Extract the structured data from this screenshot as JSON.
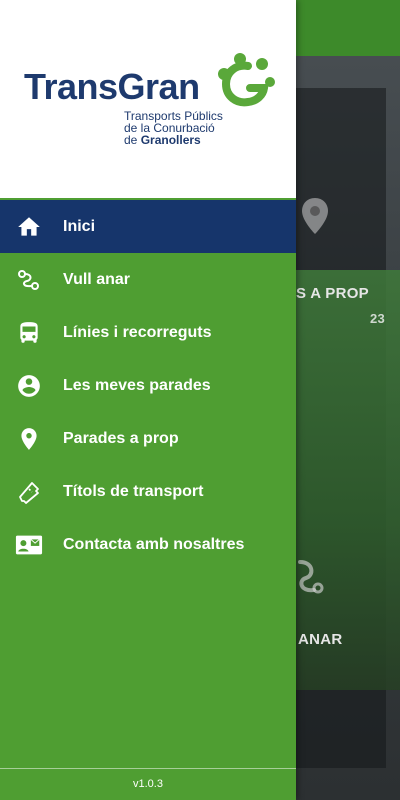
{
  "background": {
    "label_nearby": "S A PROP",
    "label_go": "ANAR",
    "bus_number": "23",
    "pin_icon": "location-pin-icon",
    "route_icon": "route-icon"
  },
  "drawer": {
    "logo": {
      "wordmark": "TransGran",
      "subtitle_line1": "Transports Públics",
      "subtitle_line2": "de la Conurbació",
      "subtitle_line3_prefix": "de ",
      "subtitle_line3_strong": "Granollers"
    },
    "items": [
      {
        "label": "Inici",
        "icon": "home-icon",
        "active": true
      },
      {
        "label": "Vull anar",
        "icon": "route-icon",
        "active": false
      },
      {
        "label": "Línies i recorreguts",
        "icon": "bus-icon",
        "active": false
      },
      {
        "label": "Les meves parades",
        "icon": "account-circle-icon",
        "active": false
      },
      {
        "label": "Parades a prop",
        "icon": "location-pin-icon",
        "active": false
      },
      {
        "label": "Títols de transport",
        "icon": "ticket-icon",
        "active": false
      },
      {
        "label": "Contacta amb nosaltres",
        "icon": "contact-card-icon",
        "active": false
      }
    ],
    "version": "v1.0.3"
  },
  "colors": {
    "drawer_green": "#4f9e32",
    "active_blue": "#16356b",
    "brand_navy": "#1e3a6e"
  }
}
